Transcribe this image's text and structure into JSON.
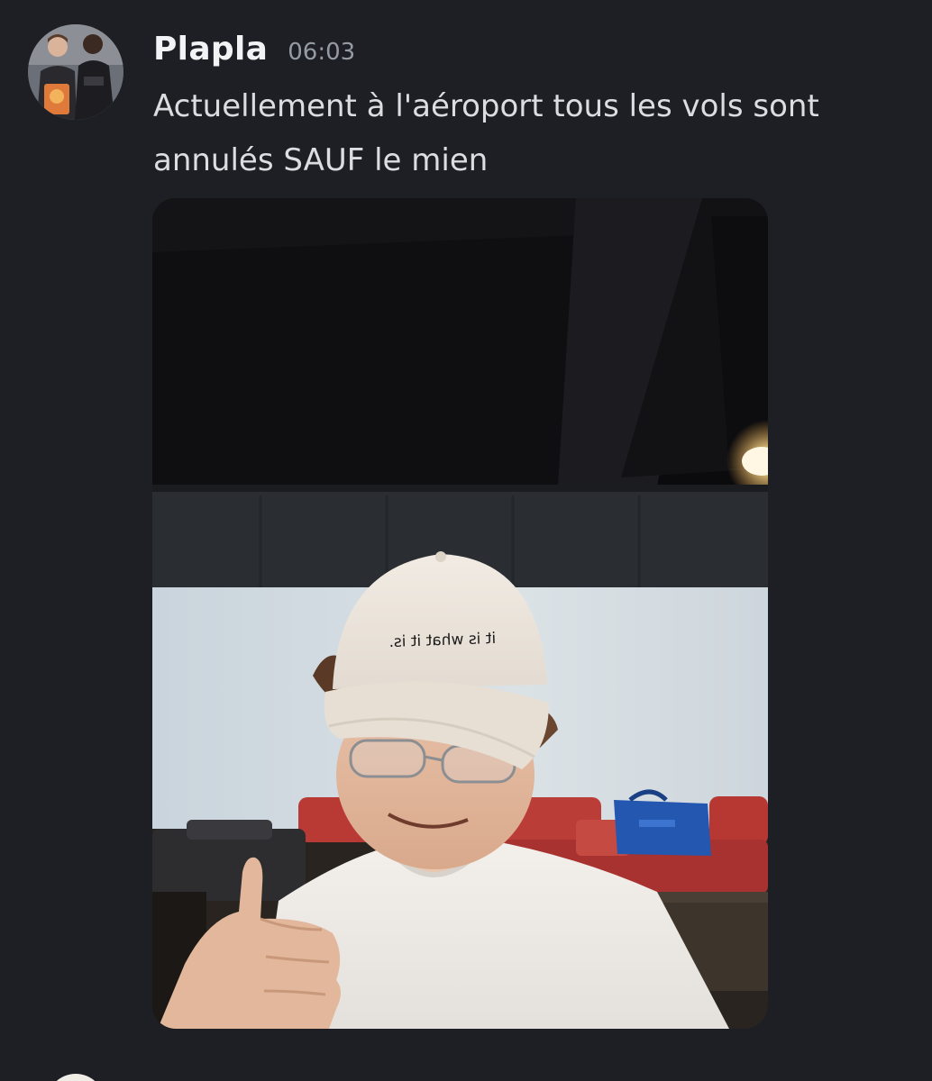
{
  "message": {
    "username": "Plapla",
    "timestamp": "06:03",
    "text": "Actuellement à l'aéroport tous les vols sont annulés SAUF le mien",
    "attachment": {
      "cap_text": "it is what it is."
    }
  },
  "colors": {
    "background": "#1e1f24",
    "username": "#f2f3f5",
    "timestamp": "#949ba4",
    "message_text": "#dbdee1"
  }
}
